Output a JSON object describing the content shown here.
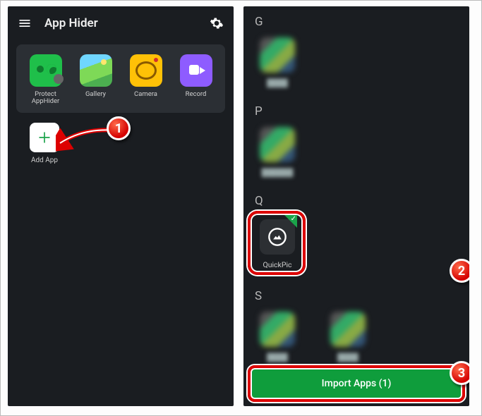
{
  "leftScreen": {
    "header": {
      "title": "App Hider"
    },
    "quickCard": {
      "items": [
        {
          "label": "Protect AppHider"
        },
        {
          "label": "Gallery"
        },
        {
          "label": "Camera"
        },
        {
          "label": "Record"
        }
      ]
    },
    "addApp": {
      "label": "Add App"
    }
  },
  "rightScreen": {
    "sections": {
      "G": {
        "letter": "G"
      },
      "P": {
        "letter": "P"
      },
      "Q": {
        "letter": "Q",
        "items": [
          {
            "name": "QuickPic",
            "selected": true
          }
        ]
      },
      "S": {
        "letter": "S"
      }
    },
    "importButton": {
      "label": "Import Apps (1)"
    }
  },
  "callouts": {
    "one": "1",
    "two": "2",
    "three": "3"
  }
}
